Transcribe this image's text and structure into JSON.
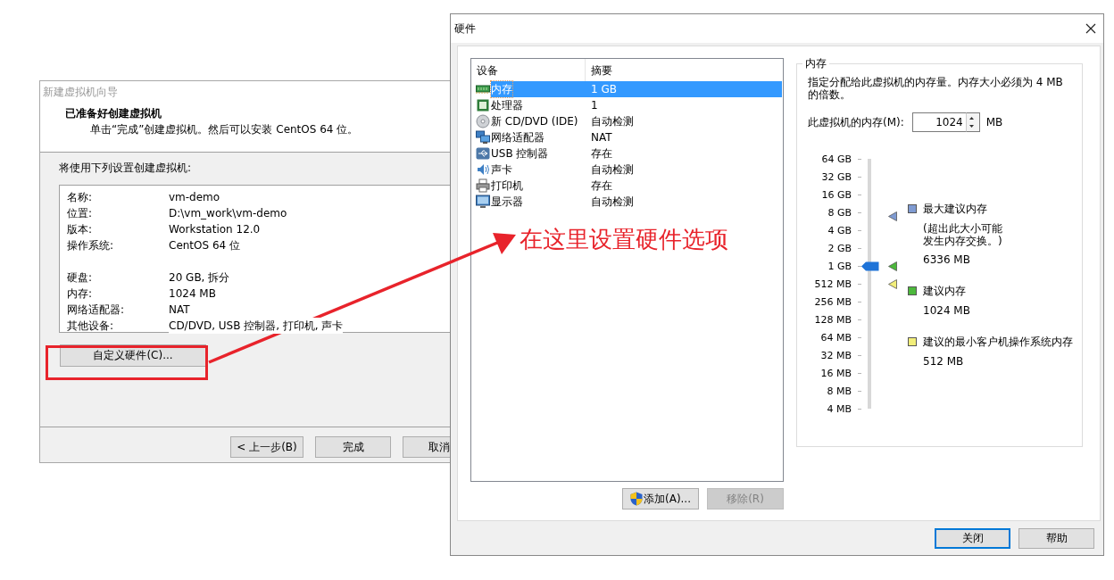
{
  "wizard": {
    "title": "新建虚拟机向导",
    "heading": "已准备好创建虚拟机",
    "subheading": "单击“完成”创建虚拟机。然后可以安装 CentOS 64 位。",
    "caption": "将使用下列设置创建虚拟机:",
    "summary_groups": [
      [
        {
          "label": "名称:",
          "value": "vm-demo"
        },
        {
          "label": "位置:",
          "value": "D:\\vm_work\\vm-demo"
        },
        {
          "label": "版本:",
          "value": "Workstation 12.0"
        },
        {
          "label": "操作系统:",
          "value": "CentOS 64 位"
        }
      ],
      [
        {
          "label": "硬盘:",
          "value": "20 GB, 拆分"
        },
        {
          "label": "内存:",
          "value": "1024 MB"
        },
        {
          "label": "网络适配器:",
          "value": "NAT"
        },
        {
          "label": "其他设备:",
          "value": "CD/DVD, USB 控制器, 打印机, 声卡"
        }
      ]
    ],
    "customize_button": "自定义硬件(C)...",
    "buttons": [
      {
        "label": "< 上一步(B)"
      },
      {
        "label": "完成"
      },
      {
        "label": "取消"
      }
    ]
  },
  "hardware": {
    "title": "硬件",
    "device_columns": [
      "设备",
      "摘要"
    ],
    "devices": [
      {
        "kind": "memory",
        "name": "内存",
        "summary": "1 GB",
        "selected": true
      },
      {
        "kind": "cpu",
        "name": "处理器",
        "summary": "1",
        "selected": false
      },
      {
        "kind": "disc",
        "name": "新 CD/DVD (IDE)",
        "summary": "自动检测",
        "selected": false
      },
      {
        "kind": "network",
        "name": "网络适配器",
        "summary": "NAT",
        "selected": false
      },
      {
        "kind": "usb",
        "name": "USB 控制器",
        "summary": "存在",
        "selected": false
      },
      {
        "kind": "sound",
        "name": "声卡",
        "summary": "自动检测",
        "selected": false
      },
      {
        "kind": "printer",
        "name": "打印机",
        "summary": "存在",
        "selected": false
      },
      {
        "kind": "display",
        "name": "显示器",
        "summary": "自动检测",
        "selected": false
      }
    ],
    "list_buttons": [
      {
        "kind": "shield",
        "label": "添加(A)...",
        "disabled": false
      },
      {
        "kind": "plain",
        "label": "移除(R)",
        "disabled": true
      }
    ],
    "memory": {
      "legend": "内存",
      "description": "指定分配给此虚拟机的内存量。内存大小必须为 4 MB 的倍数。",
      "input_label": "此虚拟机的内存(M):",
      "value": "1024",
      "unit": "MB",
      "scale": [
        "64 GB",
        "32 GB",
        "16 GB",
        "8 GB",
        "4 GB",
        "2 GB",
        "1 GB",
        "512 MB",
        "256 MB",
        "128 MB",
        "64 MB",
        "32 MB",
        "16 MB",
        "8 MB",
        "4 MB"
      ],
      "level": 0.571,
      "markers": [
        {
          "label": "最大建议内存",
          "note": "(超出此大小可能发生内存交换。)",
          "value": "6336 MB",
          "color": "#7f9bd2",
          "level": 0.77
        },
        {
          "label": "建议内存",
          "value": "1024 MB",
          "color": "#4cb83c",
          "level": 0.571
        },
        {
          "label": "建议的最小客户机操作系统内存",
          "value": "512 MB",
          "color": "#f2ee7a",
          "level": 0.5
        }
      ]
    },
    "footer_buttons": [
      {
        "label": "关闭",
        "default": true
      },
      {
        "label": "帮助",
        "default": false
      }
    ]
  },
  "annotation": {
    "text": "在这里设置硬件选项"
  }
}
